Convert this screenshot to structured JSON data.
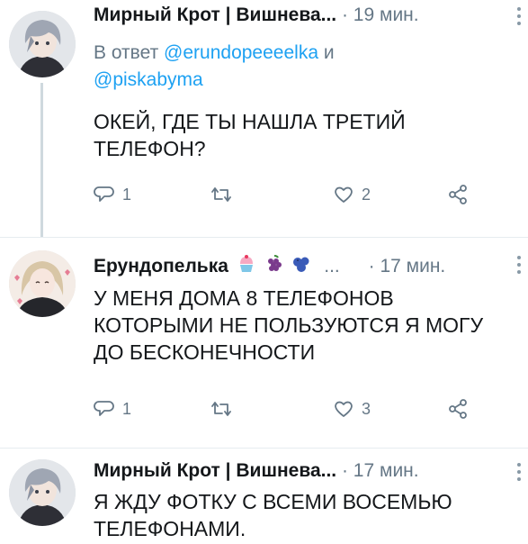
{
  "tweets": [
    {
      "name": "Мирный Крот | Вишнева...",
      "time": "· 19 мин.",
      "reply_prefix": "В ответ",
      "reply_mention_1": "@erundopeeeelka",
      "reply_joiner": "и",
      "reply_mention_2": "@piskabyma",
      "text": "ОКЕЙ, ГДЕ ТЫ НАШЛА ТРЕТИЙ ТЕЛЕФОН?",
      "reply_count": "1",
      "retweet_count": "",
      "like_count": "2"
    },
    {
      "name": "Ерундопелька",
      "name_suffix": "...",
      "emojis": [
        "cupcake-emoji",
        "grapes-emoji",
        "blueberries-emoji"
      ],
      "time": "· 17 мин.",
      "text": "У МЕНЯ ДОМА 8 ТЕЛЕФОНОВ КОТОРЫМИ НЕ ПОЛЬЗУЮТСЯ Я МОГУ ДО БЕСКОНЕЧНОСТИ",
      "reply_count": "1",
      "retweet_count": "",
      "like_count": "3"
    },
    {
      "name": "Мирный Крот | Вишнева...",
      "time": "· 17 мин.",
      "text": "Я ЖДУ ФОТКУ С ВСЕМИ ВОСЕМЬЮ ТЕЛЕФОНАМИ."
    }
  ],
  "colors": {
    "text": "#14171a",
    "secondary": "#657786",
    "link": "#1da1f2",
    "thread_line": "#cfd9de"
  },
  "icons": [
    "reply-icon",
    "retweet-icon",
    "like-icon",
    "share-icon",
    "more-icon"
  ]
}
